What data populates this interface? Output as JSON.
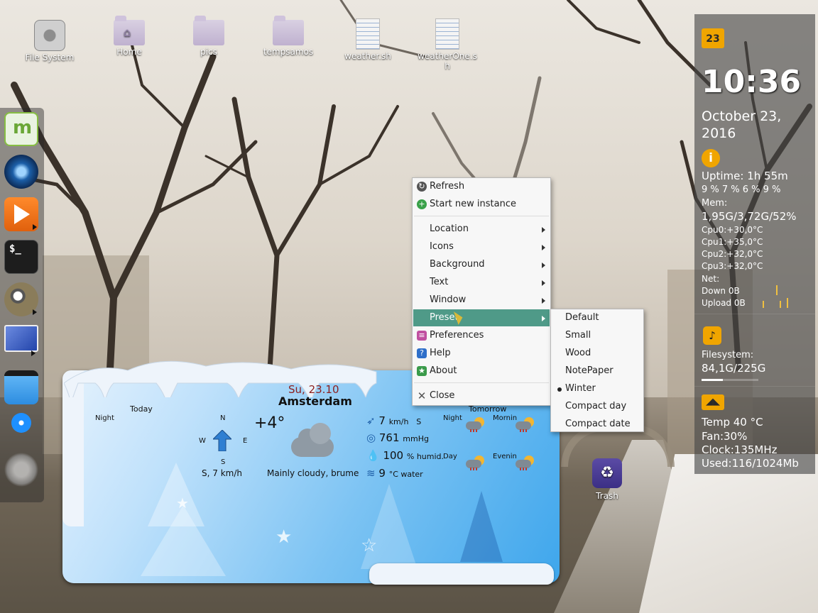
{
  "desktop_icons": [
    {
      "label": "File System",
      "icon": "hard-disk-icon"
    },
    {
      "label": "Home",
      "icon": "home-folder-icon"
    },
    {
      "label": "pics",
      "icon": "folder-icon"
    },
    {
      "label": "tempsamos",
      "icon": "folder-icon"
    },
    {
      "label": "weather.sh",
      "icon": "script-icon"
    },
    {
      "label": "weatherOne.sh",
      "icon": "script-icon"
    }
  ],
  "trash": {
    "label": "Trash",
    "icon": "trash-icon"
  },
  "dock": {
    "items": [
      "mint-menu-icon",
      "browser-icon",
      "media-player-icon",
      "terminal-icon",
      "gimp-icon",
      "monitor-icon",
      "file-manager-icon",
      "messenger-icon",
      "weather-app-icon"
    ]
  },
  "conky": {
    "calendar_day": "23",
    "time": "10:36",
    "date_line1": "October 23,",
    "date_line2": "2016",
    "uptime": "Uptime: 1h 55m",
    "cpu_percent": " 9 % 7 % 6 % 9 %",
    "mem_label": "Mem:",
    "mem_value": "1,95G/3,72G/52%",
    "cpu0": "Cpu0:+30,0°C",
    "cpu1": "Cpu1:+35,0°C",
    "cpu2": "Cpu2:+32,0°C",
    "cpu3": "Cpu3:+32,0°C",
    "net_label": "Net:",
    "down": "Down 0B",
    "upload": "Upload 0B",
    "filesystem_label": "Filesystem:",
    "filesystem_value": "84,1G/225G",
    "filesystem_used_fraction": 0.37,
    "temp": "Temp 40 °C",
    "fan": "Fan:30%",
    "clock": "Clock:135MHz",
    "used": "Used:116/1024Mb",
    "accent_color": "#f0a500"
  },
  "weather": {
    "date": "Su, 23.10",
    "city": "Amsterdam",
    "today_label": "Today",
    "night_label": "Night",
    "temperature": "+4°",
    "condition": "Mainly cloudy, brume",
    "compass": {
      "n": "N",
      "s": "S",
      "e": "E",
      "w": "W"
    },
    "wind_summary": "S, 7 km/h",
    "wind_speed": "7",
    "wind_unit": "km/h",
    "wind_dir": "S",
    "pressure": "761",
    "pressure_unit": "mmHg",
    "humidity": "100",
    "humidity_unit": "% humid.",
    "water_temp": "9",
    "water_unit": "°C water",
    "tomorrow_label": "Tomorrow",
    "forecast": {
      "night": "Night",
      "morning": "Mornin",
      "day": "Day",
      "evening": "Evenin"
    }
  },
  "context_menu": {
    "items": [
      {
        "label": "Refresh",
        "icon": "refresh-icon",
        "submenu": false
      },
      {
        "label": "Start new instance",
        "icon": "add-icon",
        "submenu": false
      },
      {
        "label": "Location",
        "submenu": true
      },
      {
        "label": "Icons",
        "submenu": true
      },
      {
        "label": "Background",
        "submenu": true
      },
      {
        "label": "Text",
        "submenu": true
      },
      {
        "label": "Window",
        "submenu": true
      },
      {
        "label": "Preset",
        "submenu": true,
        "highlighted": true
      },
      {
        "label": "Preferences",
        "icon": "preferences-icon",
        "submenu": false
      },
      {
        "label": "Help",
        "icon": "help-icon",
        "submenu": false
      },
      {
        "label": "About",
        "icon": "about-icon",
        "submenu": false
      },
      {
        "label": "Close",
        "icon": "close-icon",
        "submenu": false
      }
    ],
    "highlight_color": "#4f9a88"
  },
  "preset_submenu": {
    "items": [
      "Default",
      "Small",
      "Wood",
      "NotePaper",
      "Winter",
      "Compact day",
      "Compact date"
    ],
    "selected": "Winter"
  }
}
